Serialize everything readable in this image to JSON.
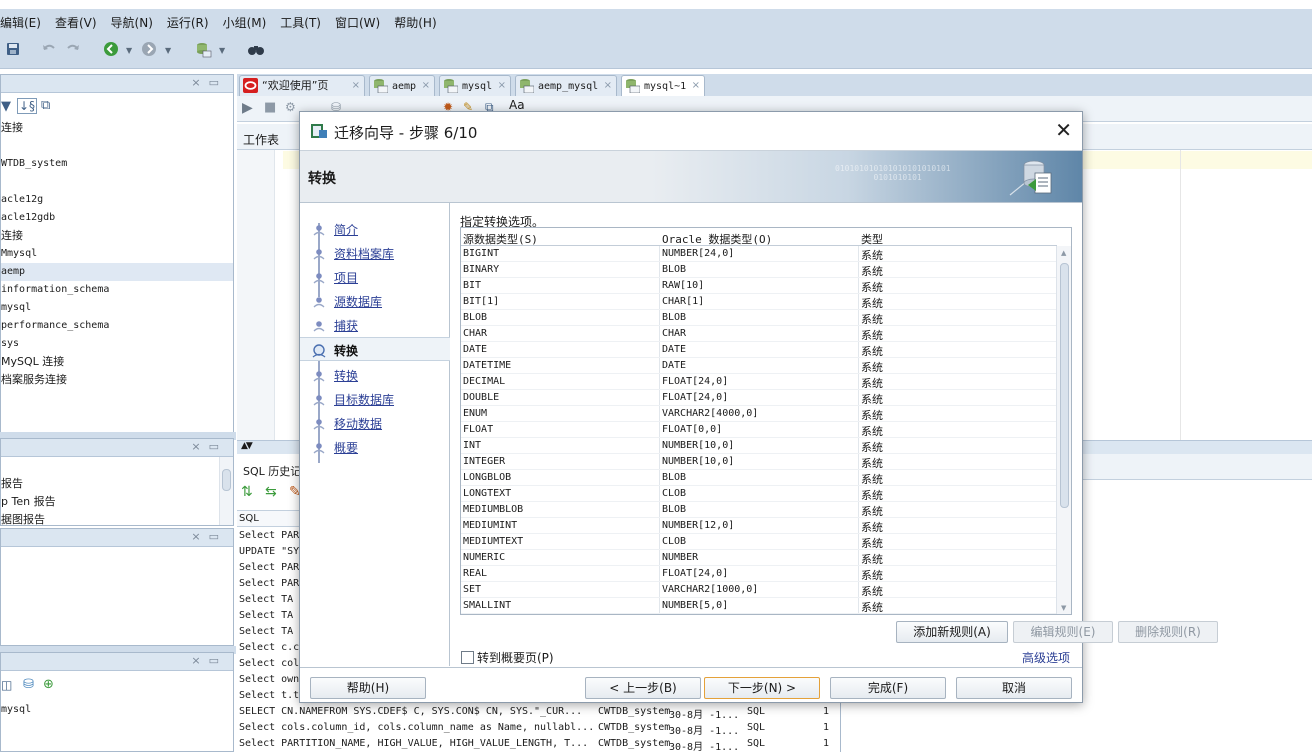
{
  "menubar": {
    "items": [
      "编辑(E)",
      "查看(V)",
      "导航(N)",
      "运行(R)",
      "小组(M)",
      "工具(T)",
      "窗口(W)",
      "帮助(H)"
    ]
  },
  "left_panels": {
    "connections": {
      "items": [
        "连接",
        "",
        "WTDB_system",
        "",
        "acle12g",
        "acle12gdb",
        "连接",
        "Mmysql",
        "aemp",
        "information_schema",
        "mysql",
        "performance_schema",
        "sys",
        "MySQL 连接",
        "档案服务连接"
      ]
    },
    "reports": {
      "items": [
        "",
        "报告",
        "p Ten 报告",
        "据图报告"
      ]
    },
    "lower": {
      "items": [
        "mysql"
      ]
    }
  },
  "tabs": [
    {
      "label": "“欢迎使用”页",
      "icon": "oracle-logo-icon"
    },
    {
      "label": "aemp",
      "icon": "sql-worksheet-icon"
    },
    {
      "label": "mysql",
      "icon": "sql-worksheet-icon"
    },
    {
      "label": "aemp_mysql",
      "icon": "sql-worksheet-icon"
    },
    {
      "label": "mysql~1",
      "icon": "sql-worksheet-icon"
    }
  ],
  "editor": {
    "worksheet_tab": "工作表",
    "toolbar_text": "Aa"
  },
  "sql_history": {
    "title": "SQL 历史记",
    "column": "SQL",
    "rows": [
      {
        "sql": "Select PAR",
        "conn": "",
        "time": "",
        "type": "",
        "count": ""
      },
      {
        "sql": "UPDATE \"SY",
        "conn": "",
        "time": "",
        "type": "",
        "count": ""
      },
      {
        "sql": "Select PAR",
        "conn": "",
        "time": "",
        "type": "",
        "count": ""
      },
      {
        "sql": "Select PAR",
        "conn": "",
        "time": "",
        "type": "",
        "count": ""
      },
      {
        "sql": "Select  TA",
        "conn": "",
        "time": "",
        "type": "",
        "count": ""
      },
      {
        "sql": "Select  TA",
        "conn": "",
        "time": "",
        "type": "",
        "count": ""
      },
      {
        "sql": "Select  TA",
        "conn": "",
        "time": "",
        "type": "",
        "count": ""
      },
      {
        "sql": "Select c.c",
        "conn": "",
        "time": "",
        "type": "",
        "count": ""
      },
      {
        "sql": "Select col",
        "conn": "",
        "time": "",
        "type": "",
        "count": ""
      },
      {
        "sql": "Select own",
        "conn": "",
        "time": "",
        "type": "",
        "count": ""
      },
      {
        "sql": "Select t.t",
        "conn": "",
        "time": "",
        "type": "",
        "count": ""
      },
      {
        "sql": "SELECT CN.NAMEFROM   SYS.CDEF$ C, SYS.CON$ CN, SYS.\"_CUR...",
        "conn": "CWTDB_system",
        "time": "30-8月 -1...",
        "type": "SQL",
        "count": "1"
      },
      {
        "sql": "Select cols.column_id, cols.column_name as Name, nullabl...",
        "conn": "CWTDB_system",
        "time": "30-8月 -1...",
        "type": "SQL",
        "count": "1"
      },
      {
        "sql": "Select PARTITION_NAME,  HIGH_VALUE, HIGH_VALUE_LENGTH, T...",
        "conn": "CWTDB_system",
        "time": "30-8月 -1...",
        "type": "SQL",
        "count": "1"
      }
    ]
  },
  "dialog": {
    "title": "迁移向导 - 步骤 6/10",
    "banner_title": "转换",
    "banner_digits": "010101010101010101010101\n        0101010101",
    "nav": [
      {
        "label": "简介",
        "current": false
      },
      {
        "label": "资料档案库",
        "current": false
      },
      {
        "label": "项目",
        "current": false
      },
      {
        "label": "源数据库",
        "current": false
      },
      {
        "label": "捕获",
        "current": false
      },
      {
        "label": "转换",
        "current": true
      },
      {
        "label": "转换",
        "current": false
      },
      {
        "label": "目标数据库",
        "current": false
      },
      {
        "label": "移动数据",
        "current": false
      },
      {
        "label": "概要",
        "current": false
      }
    ],
    "options_label": "指定转换选项。",
    "grid": {
      "columns": [
        "源数据类型(S)",
        "Oracle 数据类型(O)",
        "类型"
      ],
      "rows": [
        [
          "BIGINT",
          "NUMBER[24,0]",
          "系统"
        ],
        [
          "BINARY",
          "BLOB",
          "系统"
        ],
        [
          "BIT",
          "RAW[10]",
          "系统"
        ],
        [
          "BIT[1]",
          "CHAR[1]",
          "系统"
        ],
        [
          "BLOB",
          "BLOB",
          "系统"
        ],
        [
          "CHAR",
          "CHAR",
          "系统"
        ],
        [
          "DATE",
          "DATE",
          "系统"
        ],
        [
          "DATETIME",
          "DATE",
          "系统"
        ],
        [
          "DECIMAL",
          "FLOAT[24,0]",
          "系统"
        ],
        [
          "DOUBLE",
          "FLOAT[24,0]",
          "系统"
        ],
        [
          "ENUM",
          "VARCHAR2[4000,0]",
          "系统"
        ],
        [
          "FLOAT",
          "FLOAT[0,0]",
          "系统"
        ],
        [
          "INT",
          "NUMBER[10,0]",
          "系统"
        ],
        [
          "INTEGER",
          "NUMBER[10,0]",
          "系统"
        ],
        [
          "LONGBLOB",
          "BLOB",
          "系统"
        ],
        [
          "LONGTEXT",
          "CLOB",
          "系统"
        ],
        [
          "MEDIUMBLOB",
          "BLOB",
          "系统"
        ],
        [
          "MEDIUMINT",
          "NUMBER[12,0]",
          "系统"
        ],
        [
          "MEDIUMTEXT",
          "CLOB",
          "系统"
        ],
        [
          "NUMERIC",
          "NUMBER",
          "系统"
        ],
        [
          "REAL",
          "FLOAT[24,0]",
          "系统"
        ],
        [
          "SET",
          "VARCHAR2[1000,0]",
          "系统"
        ],
        [
          "SMALLINT",
          "NUMBER[5,0]",
          "系统"
        ]
      ]
    },
    "buttons": {
      "add_rule": "添加新规则(A)",
      "edit_rule": "编辑规则(E)",
      "delete_rule": "删除规则(R)",
      "help": "帮助(H)",
      "back": "< 上一步(B)",
      "next": "下一步(N) >",
      "finish": "完成(F)",
      "cancel": "取消"
    },
    "goto_summary": "转到概要页(P)",
    "advanced": "高级选项"
  },
  "colors": {
    "chrome": "#cfdcea",
    "link": "#2b3f95",
    "focus": "#e4a13a"
  }
}
